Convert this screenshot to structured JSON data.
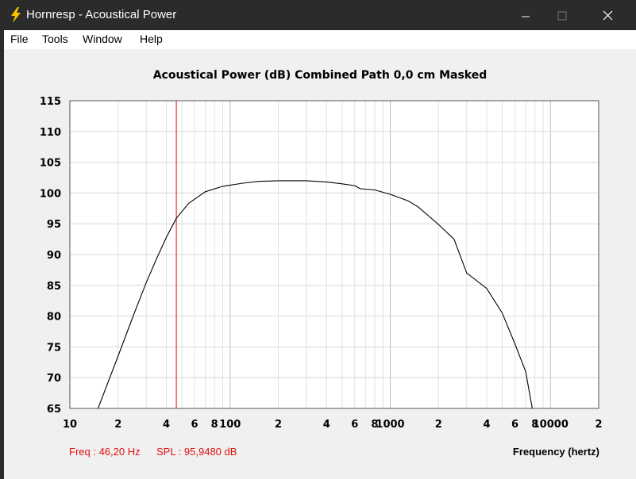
{
  "window": {
    "title": "Hornresp - Acoustical Power",
    "icon": "lightning-icon"
  },
  "menu": [
    "File",
    "Tools",
    "Window",
    "Help"
  ],
  "status": {
    "freq": "Freq : 46,20 Hz",
    "spl": "SPL : 95,9480 dB"
  },
  "chart_data": {
    "type": "line",
    "title": "Acoustical Power (dB)   Combined   Path 0,0 cm   Masked",
    "xlabel": "Frequency (hertz)",
    "ylabel": "",
    "xscale": "log",
    "xlim": [
      10,
      20000
    ],
    "ylim": [
      65,
      115
    ],
    "y_ticks": [
      115,
      110,
      105,
      100,
      95,
      90,
      85,
      80,
      75,
      70,
      65
    ],
    "x_tick_labels": [
      {
        "x": 10,
        "label": "10"
      },
      {
        "x": 20,
        "label": "2"
      },
      {
        "x": 40,
        "label": "4"
      },
      {
        "x": 60,
        "label": "6"
      },
      {
        "x": 80,
        "label": "8"
      },
      {
        "x": 100,
        "label": "100"
      },
      {
        "x": 200,
        "label": "2"
      },
      {
        "x": 400,
        "label": "4"
      },
      {
        "x": 600,
        "label": "6"
      },
      {
        "x": 800,
        "label": "8"
      },
      {
        "x": 1000,
        "label": "1000"
      },
      {
        "x": 2000,
        "label": "2"
      },
      {
        "x": 4000,
        "label": "4"
      },
      {
        "x": 6000,
        "label": "6"
      },
      {
        "x": 8000,
        "label": "8"
      },
      {
        "x": 10000,
        "label": "10000"
      },
      {
        "x": 20000,
        "label": "2"
      }
    ],
    "grid": true,
    "marker_freq": 46.2,
    "line_color": "#000000",
    "marker_color": "#e01010",
    "series": [
      {
        "x": [
          15,
          20,
          25,
          30,
          35,
          40,
          46.2,
          55,
          70,
          90,
          120,
          150,
          200,
          250,
          300,
          400,
          500,
          600,
          620,
          650,
          800,
          1000,
          1300,
          1500,
          2000,
          2500,
          3000,
          4000,
          5000,
          6000,
          7000,
          7700
        ],
        "y": [
          65,
          73.5,
          80.2,
          85.5,
          89.5,
          92.8,
          95.9,
          98.3,
          100.2,
          101.1,
          101.6,
          101.9,
          102.0,
          102.0,
          102.0,
          101.8,
          101.5,
          101.2,
          101.0,
          100.7,
          100.5,
          99.8,
          98.7,
          97.7,
          94.9,
          92.5,
          87.0,
          84.5,
          80.5,
          75.5,
          71.0,
          65.0
        ]
      }
    ]
  }
}
